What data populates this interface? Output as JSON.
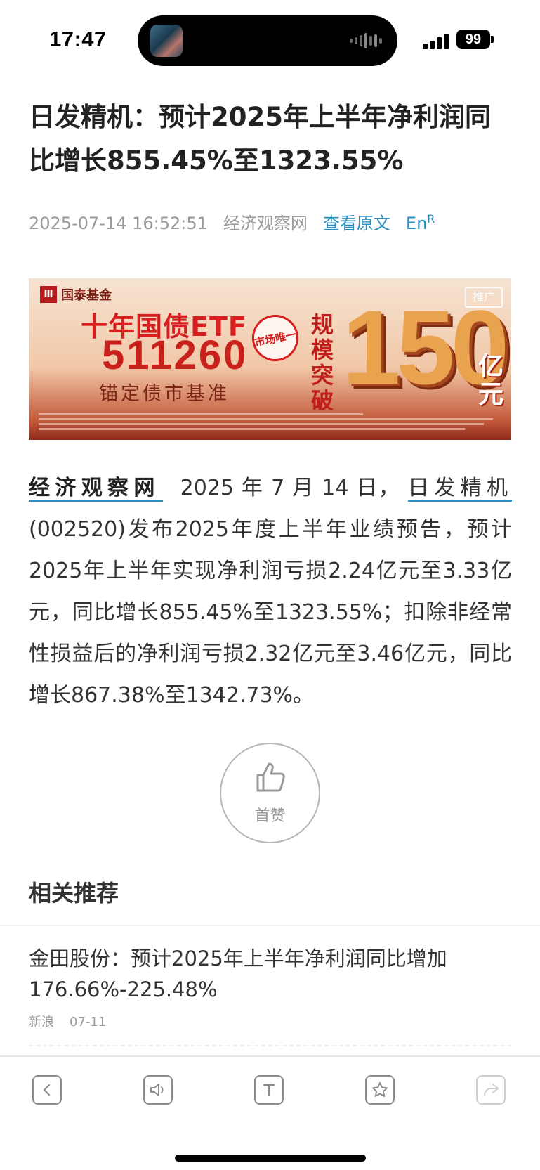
{
  "status_bar": {
    "time": "17:47",
    "battery": "99"
  },
  "article": {
    "title": "日发精机：预计2025年上半年净利润同比增长855.45%至1323.55%",
    "datetime": "2025-07-14 16:52:51",
    "source": "经济观察网",
    "view_original": "查看原文",
    "lang_toggle": "En",
    "lang_toggle_sup": "R",
    "body_source": "经济观察网",
    "body_date": "2025 年 7 月 14 日，",
    "body_stock": "日发精机",
    "body_rest": "(002520)发布2025年度上半年业绩预告，预计2025年上半年实现净利润亏损2.24亿元至3.33亿元，同比增长855.45%至1323.55%；扣除非经常性损益后的净利润亏损2.32亿元至3.46亿元，同比增长867.38%至1342.73%。"
  },
  "ad": {
    "brand": "国泰基金",
    "tag": "推广",
    "headline": "十年国债ETF",
    "code": "511260",
    "subline": "锚定债市基准",
    "seal": "市场唯一",
    "vertical": "规模突破",
    "big_number": "150",
    "unit": "亿元"
  },
  "like": {
    "label": "首赞"
  },
  "related": {
    "heading": "相关推荐",
    "items": [
      {
        "title": "金田股份：预计2025年上半年净利润同比增加176.66%-225.48%",
        "source": "新浪",
        "date": "07-11"
      }
    ]
  },
  "toolbar": {
    "icons": [
      "back-icon",
      "audio-icon",
      "text-size-icon",
      "favorite-icon",
      "share-icon"
    ]
  }
}
